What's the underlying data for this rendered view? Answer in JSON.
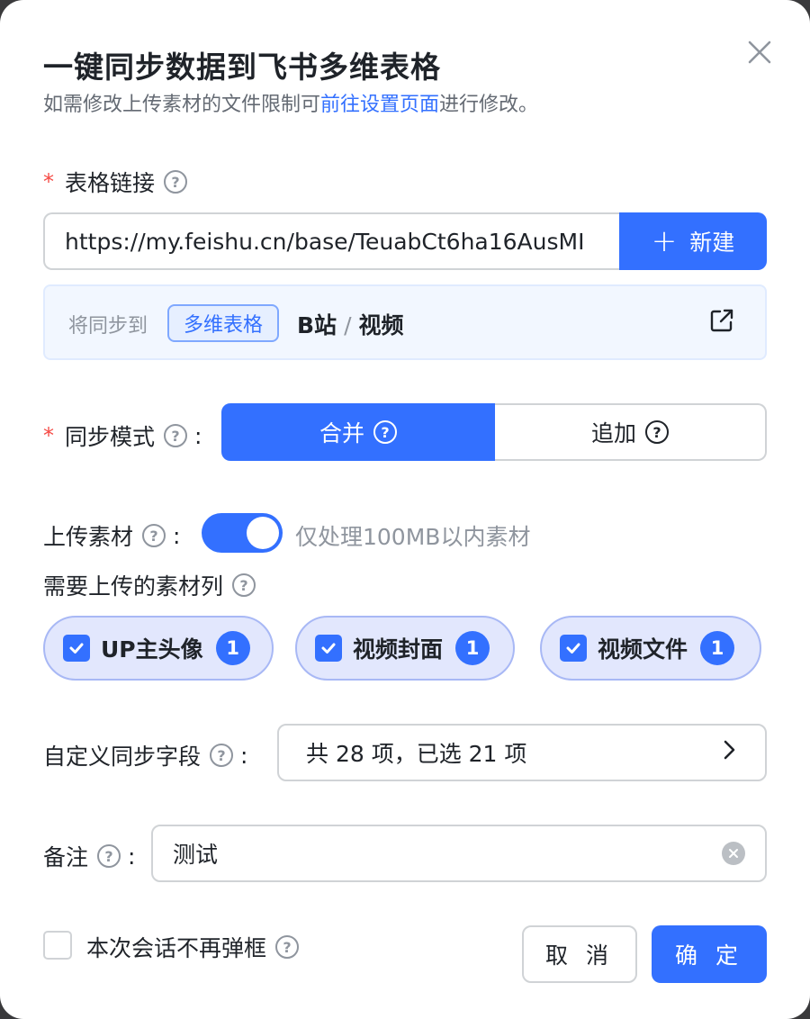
{
  "dialog": {
    "title": "一键同步数据到飞书多维表格",
    "subtitle_prefix": "如需修改上传素材的文件限制可",
    "subtitle_link": "前往设置页面",
    "subtitle_suffix": "进行修改。"
  },
  "table_link": {
    "required_mark": "*",
    "label": "表格链接",
    "help": "?",
    "value": "https://my.feishu.cn/base/TeuabCt6ha16AusMI",
    "new_button_label": "新建",
    "new_button_icon": "plus-icon"
  },
  "sync_target": {
    "prefix": "将同步到",
    "tag": "多维表格",
    "path_base": "B站",
    "path_separator": "/",
    "path_table": "视频",
    "open_icon": "external-link-icon"
  },
  "sync_mode": {
    "required_mark": "*",
    "label": "同步模式",
    "colon": ":",
    "help": "?",
    "options": [
      {
        "label": "合并",
        "selected": true
      },
      {
        "label": "追加",
        "selected": false
      }
    ]
  },
  "upload": {
    "label": "上传素材",
    "colon": ":",
    "help": "?",
    "enabled": true,
    "hint": "仅处理100MB以内素材"
  },
  "material_columns": {
    "label": "需要上传的素材列",
    "help": "?",
    "items": [
      {
        "label": "UP主头像",
        "count": "1",
        "checked": true
      },
      {
        "label": "视频封面",
        "count": "1",
        "checked": true
      },
      {
        "label": "视频文件",
        "count": "1",
        "checked": true
      }
    ]
  },
  "custom_fields": {
    "label": "自定义同步字段",
    "colon": ":",
    "help": "?",
    "value": "共 28 项，已选 21 项"
  },
  "note": {
    "label": "备注",
    "colon": ":",
    "help": "?",
    "value": "测试"
  },
  "footer": {
    "dont_show_label": "本次会话不再弹框",
    "help": "?",
    "cancel_label": "取 消",
    "ok_label": "确 定"
  },
  "colors": {
    "primary": "#3370ff",
    "required": "#f54a45",
    "chip_bg": "#e2e7fd"
  }
}
